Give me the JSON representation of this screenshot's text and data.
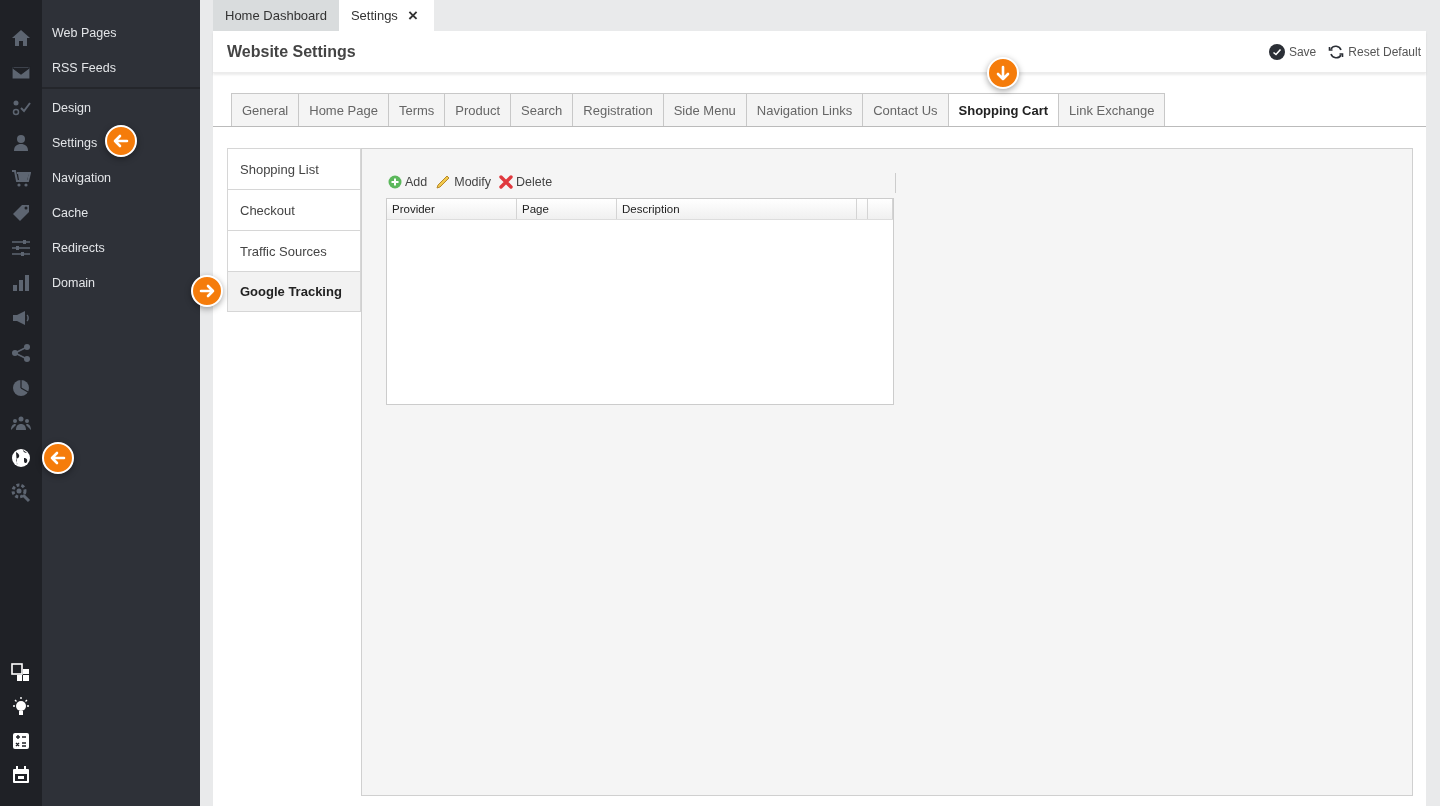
{
  "rail_icons": [
    {
      "kind": "home",
      "selected": false,
      "callout": false
    },
    {
      "kind": "mail",
      "selected": false,
      "callout": false
    },
    {
      "kind": "tasks",
      "selected": false,
      "callout": false
    },
    {
      "kind": "user",
      "selected": false,
      "callout": false
    },
    {
      "kind": "cart",
      "selected": false,
      "callout": false
    },
    {
      "kind": "tag",
      "selected": false,
      "callout": false
    },
    {
      "kind": "sliders",
      "selected": false,
      "callout": false
    },
    {
      "kind": "bars",
      "selected": false,
      "callout": false
    },
    {
      "kind": "megaphone",
      "selected": false,
      "callout": false
    },
    {
      "kind": "share",
      "selected": false,
      "callout": false
    },
    {
      "kind": "pie",
      "selected": false,
      "callout": false
    },
    {
      "kind": "team",
      "selected": false,
      "callout": false
    },
    {
      "kind": "globe",
      "selected": true,
      "callout": true
    },
    {
      "kind": "gear-search",
      "selected": false,
      "callout": false
    }
  ],
  "rail_bottom_icons": [
    {
      "kind": "windows"
    },
    {
      "kind": "bulb"
    },
    {
      "kind": "calculator"
    },
    {
      "kind": "calendar"
    }
  ],
  "submenu": {
    "groups": [
      [
        {
          "label": "Web Pages",
          "callout": false
        },
        {
          "label": "RSS Feeds",
          "callout": false
        }
      ],
      [
        {
          "label": "Design",
          "callout": false
        },
        {
          "label": "Settings",
          "callout": true
        },
        {
          "label": "Navigation",
          "callout": false
        },
        {
          "label": "Cache",
          "callout": false
        },
        {
          "label": "Redirects",
          "callout": false
        },
        {
          "label": "Domain",
          "callout": false
        }
      ]
    ]
  },
  "doc_tabs": [
    {
      "label": "Home Dashboard",
      "selected": false,
      "closable": false
    },
    {
      "label": "Settings",
      "selected": true,
      "closable": true,
      "close_glyph": "×"
    }
  ],
  "page": {
    "title": "Website Settings",
    "actions": [
      {
        "kind": "save",
        "label": "Save"
      },
      {
        "kind": "reset",
        "label": "Reset Default"
      }
    ]
  },
  "settings_tabs": [
    {
      "label": "General",
      "selected": false,
      "callout": false
    },
    {
      "label": "Home Page",
      "selected": false,
      "callout": false
    },
    {
      "label": "Terms",
      "selected": false,
      "callout": false
    },
    {
      "label": "Product",
      "selected": false,
      "callout": false
    },
    {
      "label": "Search",
      "selected": false,
      "callout": false
    },
    {
      "label": "Registration",
      "selected": false,
      "callout": false
    },
    {
      "label": "Side Menu",
      "selected": false,
      "callout": false
    },
    {
      "label": "Navigation Links",
      "selected": false,
      "callout": false
    },
    {
      "label": "Contact Us",
      "selected": false,
      "callout": false
    },
    {
      "label": "Shopping Cart",
      "selected": true,
      "callout": true
    },
    {
      "label": "Link Exchange",
      "selected": false,
      "callout": false
    }
  ],
  "side_tabs": [
    {
      "label": "Shopping List",
      "selected": false,
      "callout": false
    },
    {
      "label": "Checkout",
      "selected": false,
      "callout": false
    },
    {
      "label": "Traffic Sources",
      "selected": false,
      "callout": false
    },
    {
      "label": "Google Tracking",
      "selected": true,
      "callout": true
    }
  ],
  "toolbar": [
    {
      "kind": "add",
      "label": "Add"
    },
    {
      "kind": "modify",
      "label": "Modify"
    },
    {
      "kind": "delete",
      "label": "Delete"
    }
  ],
  "table": {
    "columns": [
      "Provider",
      "Page",
      "Description"
    ]
  }
}
